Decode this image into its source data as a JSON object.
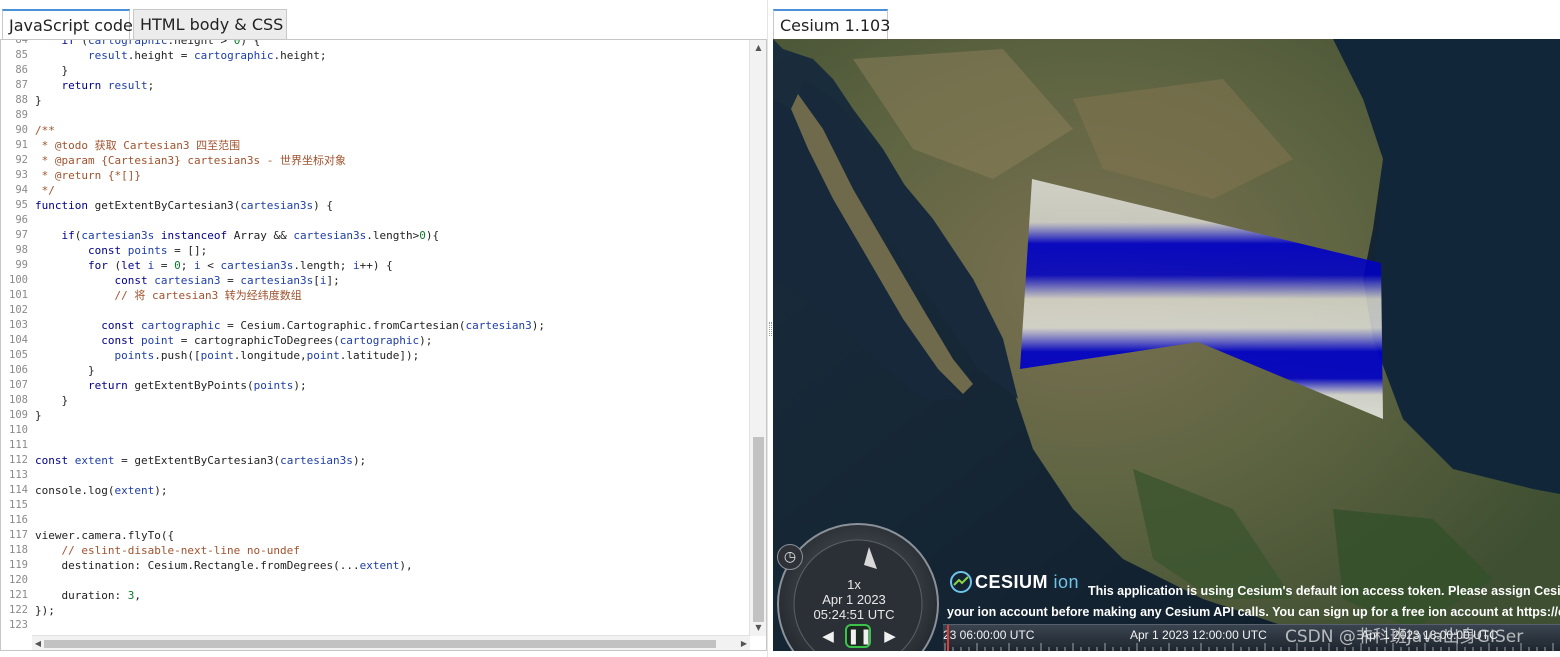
{
  "left_tabs": [
    {
      "label": "JavaScript code",
      "active": true
    },
    {
      "label": "HTML body & CSS",
      "active": false
    }
  ],
  "right_tab": {
    "label": "Cesium 1.103"
  },
  "code": {
    "first_line_number": 84,
    "lines": [
      {
        "n": "84",
        "text": "    if (cartographic.height > 0) {"
      },
      {
        "n": "85",
        "text": "        result.height = cartographic.height;"
      },
      {
        "n": "86",
        "text": "    }"
      },
      {
        "n": "87",
        "text": "    return result;"
      },
      {
        "n": "88",
        "text": "}"
      },
      {
        "n": "89",
        "text": ""
      },
      {
        "n": "90",
        "text": "/**"
      },
      {
        "n": "91",
        "text": " * @todo 获取 Cartesian3 四至范围"
      },
      {
        "n": "92",
        "text": " * @param {Cartesian3} cartesian3s - 世界坐标对象"
      },
      {
        "n": "93",
        "text": " * @return {*[]}"
      },
      {
        "n": "94",
        "text": " */"
      },
      {
        "n": "95",
        "text": "function getExtentByCartesian3(cartesian3s) {"
      },
      {
        "n": "96",
        "text": ""
      },
      {
        "n": "97",
        "text": "    if(cartesian3s instanceof Array && cartesian3s.length>0){"
      },
      {
        "n": "98",
        "text": "        const points = [];"
      },
      {
        "n": "99",
        "text": "        for (let i = 0; i < cartesian3s.length; i++) {"
      },
      {
        "n": "100",
        "text": "            const cartesian3 = cartesian3s[i];"
      },
      {
        "n": "101",
        "text": "            // 将 cartesian3 转为经纬度数组"
      },
      {
        "n": "102",
        "text": ""
      },
      {
        "n": "103",
        "text": "          const cartographic = Cesium.Cartographic.fromCartesian(cartesian3);"
      },
      {
        "n": "104",
        "text": "          const point = cartographicToDegrees(cartographic);"
      },
      {
        "n": "105",
        "text": "            points.push([point.longitude,point.latitude]);"
      },
      {
        "n": "106",
        "text": "        }"
      },
      {
        "n": "107",
        "text": "        return getExtentByPoints(points);"
      },
      {
        "n": "108",
        "text": "    }"
      },
      {
        "n": "109",
        "text": "}"
      },
      {
        "n": "110",
        "text": ""
      },
      {
        "n": "111",
        "text": ""
      },
      {
        "n": "112",
        "text": "const extent = getExtentByCartesian3(cartesian3s);"
      },
      {
        "n": "113",
        "text": ""
      },
      {
        "n": "114",
        "text": "console.log(extent);"
      },
      {
        "n": "115",
        "text": ""
      },
      {
        "n": "116",
        "text": ""
      },
      {
        "n": "117",
        "text": "viewer.camera.flyTo({"
      },
      {
        "n": "118",
        "text": "    // eslint-disable-next-line no-undef"
      },
      {
        "n": "119",
        "text": "    destination: Cesium.Rectangle.fromDegrees(...extent),"
      },
      {
        "n": "120",
        "text": ""
      },
      {
        "n": "121",
        "text": "    duration: 3,"
      },
      {
        "n": "122",
        "text": "});"
      },
      {
        "n": "123",
        "text": ""
      }
    ]
  },
  "cesium": {
    "animation": {
      "speed": "1x",
      "date": "Apr 1 2023",
      "time": "05:24:51 UTC",
      "reverse_icon": "reverse-play-icon",
      "pause_icon": "pause-icon",
      "play_icon": "play-icon"
    },
    "clock_icon": "clock-icon",
    "credit": {
      "logo_word": "CESIUM",
      "logo_suffix": "ion",
      "line1": "This application is using Cesium's default ion access token. Please assign Cesium.Ion.defaultAccessToken with an access token from",
      "line2": "your ion account before making any Cesium API calls. You can sign up for a free ion account at https://cesium.com."
    },
    "timeline": {
      "labels": [
        "23 06:00:00 UTC",
        "Apr 1 2023 12:00:00 UTC",
        "Apr 1 2023 18:00:00 UTC"
      ]
    },
    "watermark": "CSDN @非科班Java出身GISer"
  },
  "colors": {
    "accent": "#4a90d9",
    "keyword": "#00008b",
    "comment": "#a0522d",
    "rectangle_blue": "#0000c8",
    "pause_border": "#3bc24a"
  }
}
